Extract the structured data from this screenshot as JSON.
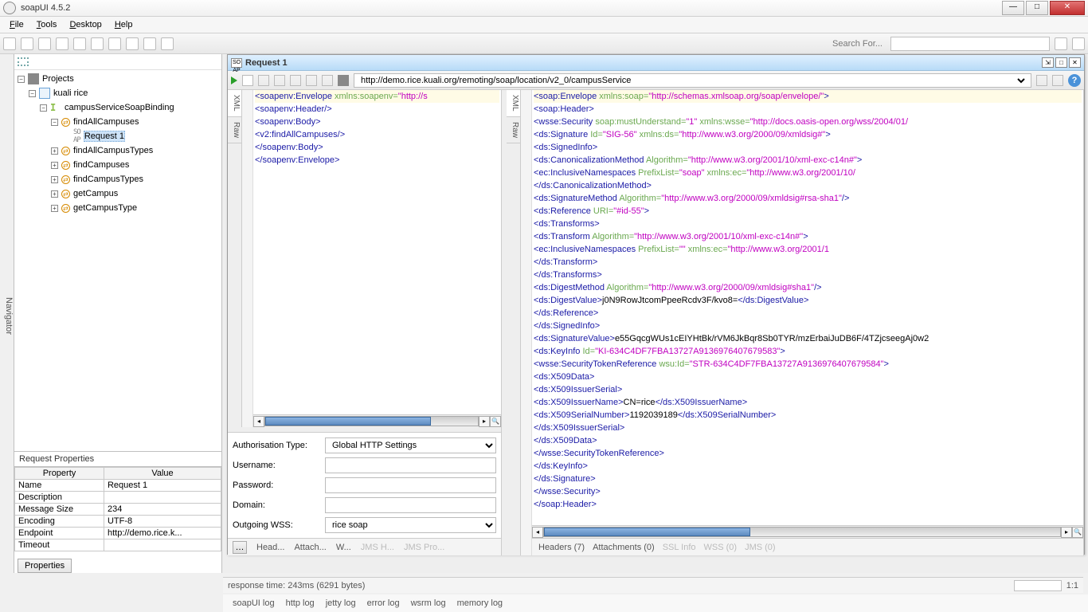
{
  "window": {
    "title": "soapUI 4.5.2"
  },
  "menu": {
    "file": "File",
    "tools": "Tools",
    "desktop": "Desktop",
    "help": "Help"
  },
  "search": {
    "label": "Search For...",
    "placeholder": ""
  },
  "navigator": {
    "tab": "Navigator",
    "root": "Projects",
    "project": "kuali rice",
    "binding": "campusServiceSoapBinding",
    "ops": [
      "findAllCampuses",
      "findAllCampusTypes",
      "findCampuses",
      "findCampusTypes",
      "getCampus",
      "getCampusType"
    ],
    "request": "Request 1"
  },
  "props": {
    "title": "Request Properties",
    "headers": [
      "Property",
      "Value"
    ],
    "rows": [
      [
        "Name",
        "Request 1"
      ],
      [
        "Description",
        ""
      ],
      [
        "Message Size",
        "234"
      ],
      [
        "Encoding",
        "UTF-8"
      ],
      [
        "Endpoint",
        "http://demo.rice.k..."
      ],
      [
        "Timeout",
        ""
      ]
    ],
    "tab": "Properties"
  },
  "req": {
    "title": "Request 1",
    "url": "http://demo.rice.kuali.org/remoting/soap/location/v2_0/campusService",
    "vtabs": [
      "XML",
      "Raw"
    ],
    "request_tokens": [
      [
        [
          "tag",
          "<soapenv:Envelope "
        ],
        [
          "attr",
          "xmlns:soapenv="
        ],
        [
          "val",
          "\"http://s"
        ]
      ],
      [
        [
          "tag",
          "   <soapenv:Header/>"
        ]
      ],
      [
        [
          "tag",
          "   <soapenv:Body>"
        ]
      ],
      [
        [
          "tag",
          "      <v2:findAllCampuses/>"
        ]
      ],
      [
        [
          "tag",
          "   </soapenv:Body>"
        ]
      ],
      [
        [
          "tag",
          "</soapenv:Envelope>"
        ]
      ]
    ],
    "auth": {
      "type_label": "Authorisation Type:",
      "type_value": "Global HTTP Settings",
      "user_label": "Username:",
      "pass_label": "Password:",
      "domain_label": "Domain:",
      "owss_label": "Outgoing WSS:",
      "owss_value": "rice soap"
    },
    "ltabs": [
      "Head...",
      "Attach...",
      "W...",
      "JMS H...",
      "JMS Pro..."
    ],
    "response_tokens": [
      [
        [
          "tag",
          "<soap:Envelope "
        ],
        [
          "attr",
          "xmlns:soap="
        ],
        [
          "val",
          "\"http://schemas.xmlsoap.org/soap/envelope/\""
        ],
        [
          "tag",
          ">"
        ]
      ],
      [
        [
          "tag",
          "   <soap:Header>"
        ]
      ],
      [
        [
          "tag",
          "      <wsse:Security "
        ],
        [
          "attr",
          "soap:mustUnderstand="
        ],
        [
          "val",
          "\"1\" "
        ],
        [
          "attr",
          "xmlns:wsse="
        ],
        [
          "val",
          "\"http://docs.oasis-open.org/wss/2004/01/"
        ]
      ],
      [
        [
          "tag",
          "         <ds:Signature "
        ],
        [
          "attr",
          "Id="
        ],
        [
          "val",
          "\"SIG-56\" "
        ],
        [
          "attr",
          "xmlns:ds="
        ],
        [
          "val",
          "\"http://www.w3.org/2000/09/xmldsig#\""
        ],
        [
          "tag",
          ">"
        ]
      ],
      [
        [
          "tag",
          "            <ds:SignedInfo>"
        ]
      ],
      [
        [
          "tag",
          "               <ds:CanonicalizationMethod "
        ],
        [
          "attr",
          "Algorithm="
        ],
        [
          "val",
          "\"http://www.w3.org/2001/10/xml-exc-c14n#\""
        ],
        [
          "tag",
          ">"
        ]
      ],
      [
        [
          "tag",
          "                  <ec:InclusiveNamespaces "
        ],
        [
          "attr",
          "PrefixList="
        ],
        [
          "val",
          "\"soap\" "
        ],
        [
          "attr",
          "xmlns:ec="
        ],
        [
          "val",
          "\"http://www.w3.org/2001/10/"
        ]
      ],
      [
        [
          "tag",
          "               </ds:CanonicalizationMethod>"
        ]
      ],
      [
        [
          "tag",
          "               <ds:SignatureMethod "
        ],
        [
          "attr",
          "Algorithm="
        ],
        [
          "val",
          "\"http://www.w3.org/2000/09/xmldsig#rsa-sha1\""
        ],
        [
          "tag",
          "/>"
        ]
      ],
      [
        [
          "tag",
          "               <ds:Reference "
        ],
        [
          "attr",
          "URI="
        ],
        [
          "val",
          "\"#id-55\""
        ],
        [
          "tag",
          ">"
        ]
      ],
      [
        [
          "tag",
          "                  <ds:Transforms>"
        ]
      ],
      [
        [
          "tag",
          "                     <ds:Transform "
        ],
        [
          "attr",
          "Algorithm="
        ],
        [
          "val",
          "\"http://www.w3.org/2001/10/xml-exc-c14n#\""
        ],
        [
          "tag",
          ">"
        ]
      ],
      [
        [
          "tag",
          "                        <ec:InclusiveNamespaces "
        ],
        [
          "attr",
          "PrefixList="
        ],
        [
          "val",
          "\"\" "
        ],
        [
          "attr",
          "xmlns:ec="
        ],
        [
          "val",
          "\"http://www.w3.org/2001/1"
        ]
      ],
      [
        [
          "tag",
          "                     </ds:Transform>"
        ]
      ],
      [
        [
          "tag",
          "                  </ds:Transforms>"
        ]
      ],
      [
        [
          "tag",
          "                  <ds:DigestMethod "
        ],
        [
          "attr",
          "Algorithm="
        ],
        [
          "val",
          "\"http://www.w3.org/2000/09/xmldsig#sha1\""
        ],
        [
          "tag",
          "/>"
        ]
      ],
      [
        [
          "tag",
          "                  <ds:DigestValue>"
        ],
        [
          "text",
          "j0N9RowJtcomPpeeRcdv3F/kvo8="
        ],
        [
          "tag",
          "</ds:DigestValue>"
        ]
      ],
      [
        [
          "tag",
          "               </ds:Reference>"
        ]
      ],
      [
        [
          "tag",
          "            </ds:SignedInfo>"
        ]
      ],
      [
        [
          "tag",
          "            <ds:SignatureValue>"
        ],
        [
          "text",
          "e55GqcgWUs1cEIYHtBk/rVM6JkBqr8Sb0TYR/mzErbaiJuDB6F/4TZjcseegAj0w2"
        ]
      ],
      [
        [
          "tag",
          "            <ds:KeyInfo "
        ],
        [
          "attr",
          "Id="
        ],
        [
          "val",
          "\"KI-634C4DF7FBA13727A9136976407679583\""
        ],
        [
          "tag",
          ">"
        ]
      ],
      [
        [
          "tag",
          "               <wsse:SecurityTokenReference "
        ],
        [
          "attr",
          "wsu:Id="
        ],
        [
          "val",
          "\"STR-634C4DF7FBA13727A9136976407679584\""
        ],
        [
          "tag",
          ">"
        ]
      ],
      [
        [
          "tag",
          "                  <ds:X509Data>"
        ]
      ],
      [
        [
          "tag",
          "                     <ds:X509IssuerSerial>"
        ]
      ],
      [
        [
          "tag",
          "                        <ds:X509IssuerName>"
        ],
        [
          "text",
          "CN=rice"
        ],
        [
          "tag",
          "</ds:X509IssuerName>"
        ]
      ],
      [
        [
          "tag",
          "                        <ds:X509SerialNumber>"
        ],
        [
          "text",
          "1192039189"
        ],
        [
          "tag",
          "</ds:X509SerialNumber>"
        ]
      ],
      [
        [
          "tag",
          "                     </ds:X509IssuerSerial>"
        ]
      ],
      [
        [
          "tag",
          "                  </ds:X509Data>"
        ]
      ],
      [
        [
          "tag",
          "               </wsse:SecurityTokenReference>"
        ]
      ],
      [
        [
          "tag",
          "            </ds:KeyInfo>"
        ]
      ],
      [
        [
          "tag",
          "         </ds:Signature>"
        ]
      ],
      [
        [
          "tag",
          "      </wsse:Security>"
        ]
      ],
      [
        [
          "tag",
          "   </soap:Header>"
        ]
      ]
    ],
    "rtabs": [
      [
        "Headers (7)",
        false
      ],
      [
        "Attachments (0)",
        false
      ],
      [
        "SSL Info",
        true
      ],
      [
        "WSS (0)",
        true
      ],
      [
        "JMS (0)",
        true
      ]
    ]
  },
  "status": {
    "text": "response time: 243ms (6291 bytes)",
    "ratio": "1:1"
  },
  "logs": [
    "soapUI log",
    "http log",
    "jetty log",
    "error log",
    "wsrm log",
    "memory log"
  ]
}
